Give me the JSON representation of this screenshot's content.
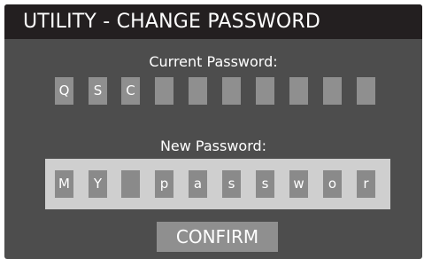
{
  "window": {
    "title": "UTILITY - CHANGE PASSWORD"
  },
  "current_password": {
    "label": "Current Password:",
    "chars": [
      "Q",
      "S",
      "C",
      "",
      "",
      "",
      "",
      "",
      "",
      ""
    ]
  },
  "new_password": {
    "label": "New Password:",
    "chars": [
      "M",
      "Y",
      "",
      "p",
      "a",
      "s",
      "s",
      "w",
      "o",
      "r"
    ]
  },
  "actions": {
    "confirm_label": "CONFIRM"
  },
  "colors": {
    "background": "#4d4d4d",
    "titlebar": "#231f20",
    "slot": "#8f8f8f",
    "new_panel": "#cfcfcf",
    "text": "#ffffff"
  }
}
